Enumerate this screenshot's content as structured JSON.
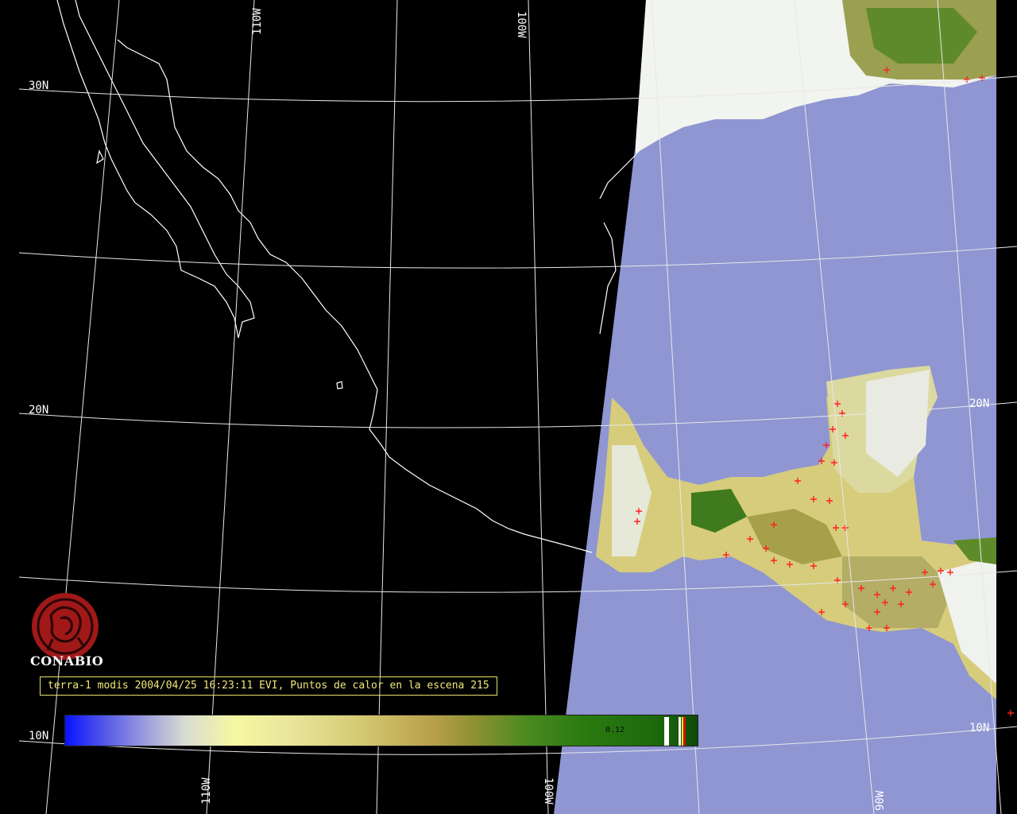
{
  "map": {
    "latitude_labels": [
      "30N",
      "20N",
      "10N",
      "20N",
      "10N"
    ],
    "longitude_labels": [
      "110W",
      "100W",
      "110W",
      "100W",
      "90W"
    ]
  },
  "logo": {
    "name": "CONABIO",
    "color": "#a01818"
  },
  "caption": {
    "text": "terra-1 modis 2004/04/25 16:23:11 EVI, Puntos de calor en la escena 215"
  },
  "colorbar": {
    "tick_label": "0.12",
    "gradient_stops": [
      "#0a12ff",
      "#a0a0dc",
      "#f6f8a0",
      "#b8a04a",
      "#2a7a10",
      "#0f4a08"
    ]
  },
  "hotspot_color": "#ff2020",
  "hotspot_count": 215
}
